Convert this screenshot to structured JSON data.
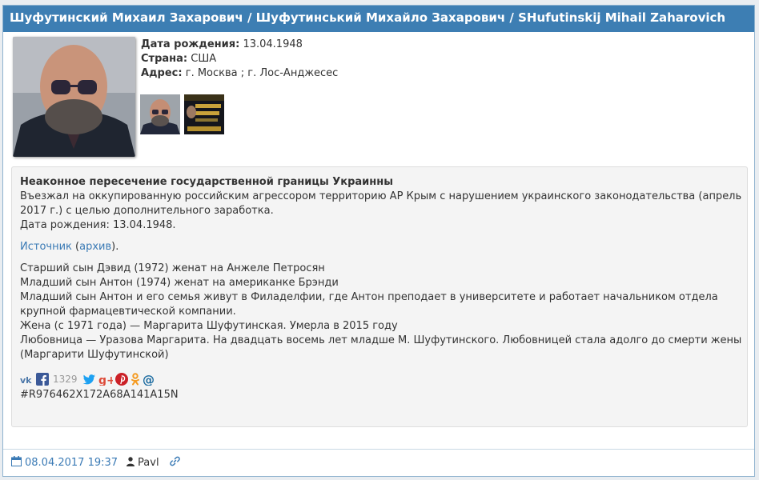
{
  "header": {
    "title": "Шуфутинский Михаил Захарович / Шуфутинський Михайло Захарович / SHufutinskij Mihail Zaharovich"
  },
  "info": {
    "birth_label": "Дата рождения:",
    "birth_value": "13.04.1948",
    "country_label": "Страна:",
    "country_value": "США",
    "address_label": "Адрес:",
    "address_value": "г. Москва ; г. Лос-Анджесес"
  },
  "description": {
    "title": "Неаконное пересечение государственной границы Украинны",
    "lines": [
      "Въезжал на оккупированную российским агрессором территорию АР Крым с нарушением украинского законодательства (апрель",
      "2017 г.) с целью дополнительного заработка.",
      "Дата рождения: 13.04.1948."
    ],
    "source_text": "Источник",
    "archive_open": " (",
    "archive_text": "архив",
    "archive_close": ").",
    "family": [
      "Старший сын Дэвид (1972) женат на Анжеле Петросян",
      "Младший сын Антон (1974) женат на американке Брэнди",
      "Младший сын Антон и его семья живут в Филаделфии, где Антон преподает в университете и работает начальником отдела",
      "крупной фармацевтической компании.",
      "Жена (с 1971 года) — Маргарита Шуфутинская. Умерла в 2015 году",
      "Любовница — Уразова Маргарита. На двадцать восемь лет младше М. Шуфутинского. Любовницей стала адолго до смерти жены",
      "(Маргарити Шуфутинской)"
    ],
    "share_count": "1329",
    "hashtag": "#R976462X172A68A141A15N"
  },
  "footer": {
    "date": "08.04.2017 19:37",
    "author": "Pavl"
  },
  "icons": [
    "vk-icon",
    "facebook-icon",
    "twitter-icon",
    "google-plus-icon",
    "pinterest-icon",
    "odnoklassniki-icon",
    "email-icon",
    "calendar-icon",
    "user-icon",
    "link-icon"
  ],
  "colors": {
    "header": "#3d7eb3",
    "link": "#3a7ab5"
  }
}
